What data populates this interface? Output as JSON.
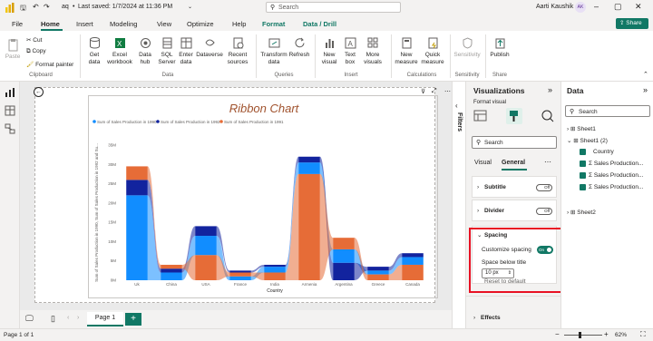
{
  "titlebar": {
    "file_title": "aq",
    "saved_status": "Last saved: 1/7/2024 at 11:36 PM",
    "search_placeholder": "Search",
    "user_name": "Aarti Kaushik",
    "user_initials": "AK"
  },
  "menu": {
    "tabs": [
      "File",
      "Home",
      "Insert",
      "Modeling",
      "View",
      "Optimize",
      "Help",
      "Format",
      "Data / Drill"
    ],
    "share": "Share"
  },
  "ribbon": {
    "clipboard": {
      "paste": "Paste",
      "cut": "Cut",
      "copy": "Copy",
      "format_painter": "Format painter",
      "label": "Clipboard"
    },
    "data": {
      "get_data": "Get data",
      "excel": "Excel workbook",
      "data_hub": "Data hub",
      "sql": "SQL Server",
      "enter": "Enter data",
      "dataverse": "Dataverse",
      "recent": "Recent sources",
      "label": "Data"
    },
    "queries": {
      "transform": "Transform data",
      "refresh": "Refresh",
      "label": "Queries"
    },
    "insert": {
      "new_visual": "New visual",
      "text_box": "Text box",
      "more_visuals": "More visuals",
      "label": "Insert"
    },
    "calculations": {
      "new_measure": "New measure",
      "quick_measure": "Quick measure",
      "label": "Calculations"
    },
    "sensitivity": {
      "sensitivity": "Sensitivity",
      "label": "Sensitivity"
    },
    "share": {
      "publish": "Publish",
      "label": "Share"
    }
  },
  "chart_data": {
    "type": "ribbon",
    "title": "Ribbon Chart",
    "xlabel": "Country",
    "ylabel": "Sum of Sales Production in 1990, Sum of Sales Production in 1992 and Su...",
    "categories": [
      "Uk",
      "China",
      "USA",
      "France",
      "India",
      "Armenia",
      "Argentina",
      "Greece",
      "Canada"
    ],
    "y_ticks": [
      "0M",
      "5M",
      "10M",
      "15M",
      "20M",
      "25M",
      "30M",
      "35M"
    ],
    "ylim": [
      0,
      35
    ],
    "series": [
      {
        "name": "Sum of Sales Production in 1990",
        "color": "#118dff",
        "values": [
          22,
          2,
          5,
          1,
          1.5,
          3,
          3.5,
          1,
          2
        ]
      },
      {
        "name": "Sum of Sales Production in 1992",
        "color": "#12239e",
        "values": [
          4,
          1,
          2.5,
          0.5,
          0.5,
          1.5,
          4.5,
          1,
          1
        ]
      },
      {
        "name": "Sum of Sales Production in 1991",
        "color": "#e66c37",
        "values": [
          3.5,
          1,
          6.5,
          1,
          2,
          27.5,
          3,
          1.5,
          4
        ]
      }
    ]
  },
  "pages": {
    "tab": "Page 1"
  },
  "viz_pane": {
    "title": "Visualizations",
    "format_visual": "Format visual",
    "search": "Search",
    "tab_visual": "Visual",
    "tab_general": "General",
    "subtitle": "Subtitle",
    "divider": "Divider",
    "off": "Off",
    "on": "On",
    "spacing": "Spacing",
    "customize_spacing": "Customize spacing",
    "space_below": "Space below title",
    "space_value": "10 px",
    "reset": "Reset to default",
    "effects": "Effects"
  },
  "filters": {
    "label": "Filters"
  },
  "data_pane": {
    "title": "Data",
    "search": "Search",
    "items": [
      "Sheet1",
      "Sheet1 (2)",
      "Country",
      "Sales Production...",
      "Sales Production...",
      "Sales Production...",
      "Sheet2"
    ]
  },
  "status": {
    "page_info": "Page 1 of 1",
    "zoom": "62%"
  }
}
